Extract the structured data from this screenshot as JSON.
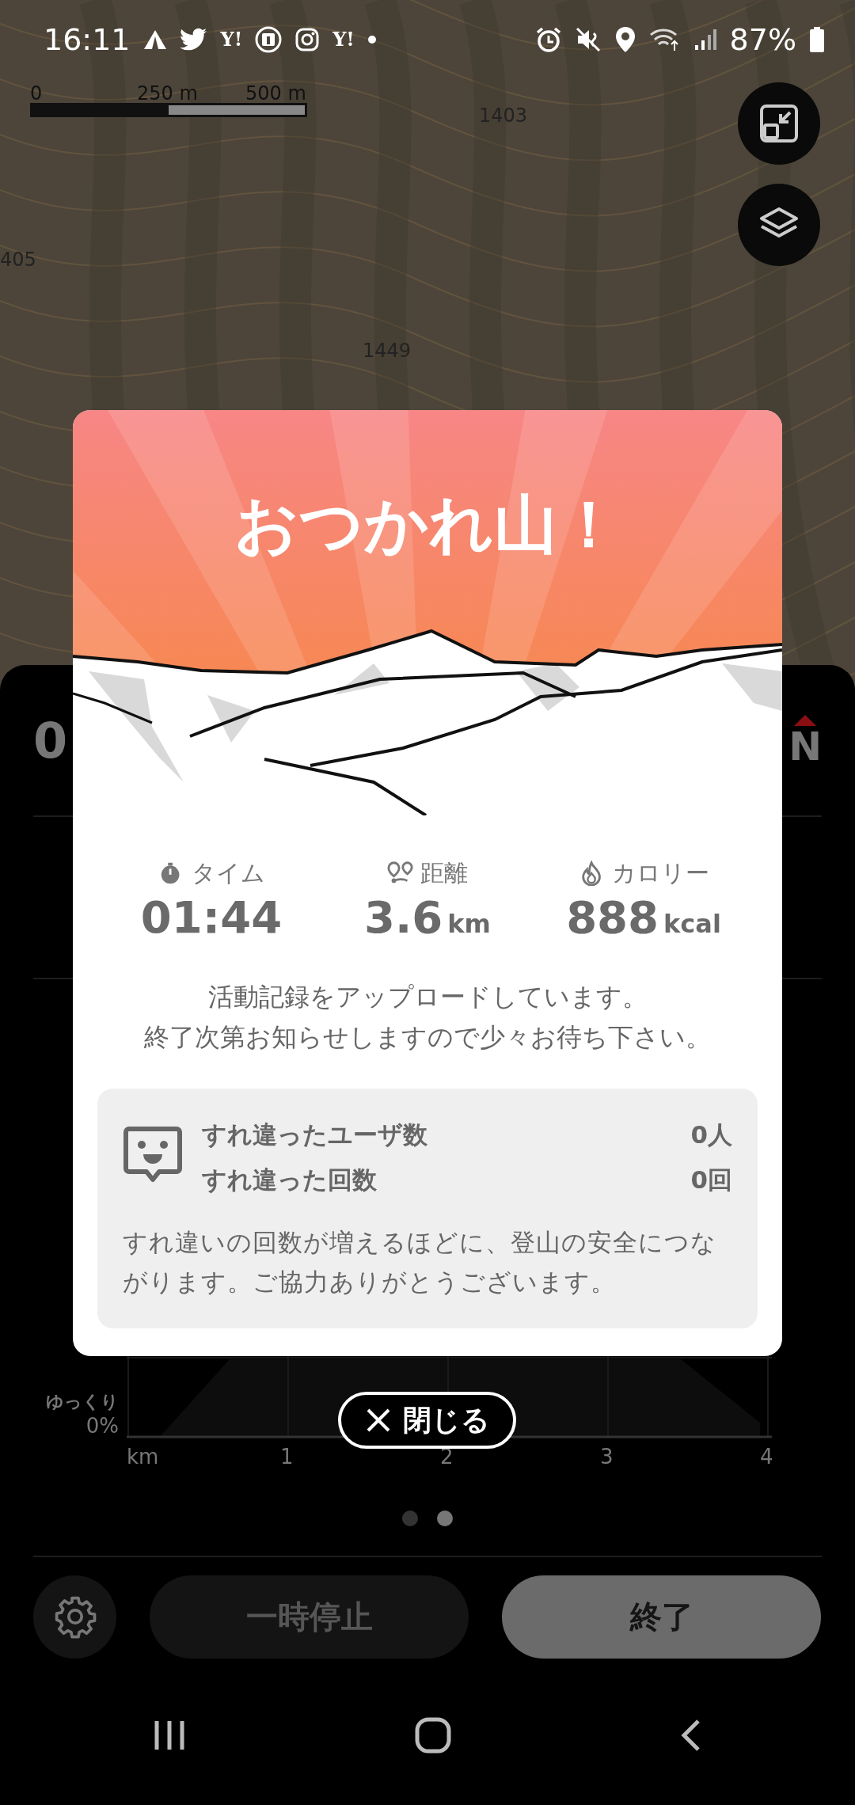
{
  "status_bar": {
    "time": "16:11",
    "app_marks": [
      "Y!",
      "Y!"
    ],
    "battery": "87%"
  },
  "map": {
    "scale_labels": [
      "0",
      "250 m",
      "500 m"
    ],
    "elevation_labels": [
      "1403",
      "405",
      "1449"
    ]
  },
  "panel": {
    "elapsed_partial": "0",
    "compass": "N",
    "chart": {
      "y_labels": [
        "ゆっくり",
        "0%"
      ],
      "x_labels": [
        "km",
        "1",
        "2",
        "3",
        "4"
      ]
    },
    "pages": [
      {
        "selected": false
      },
      {
        "selected": true
      }
    ],
    "pause_button": "一時停止",
    "end_button": "終了"
  },
  "dialog": {
    "title": "おつかれ山！",
    "stats": [
      {
        "kind": "time",
        "label": "タイム",
        "value": "01:44"
      },
      {
        "kind": "distance",
        "label": "距離",
        "value": "3.6",
        "unit": "km"
      },
      {
        "kind": "calorie",
        "label": "カロリー",
        "value": "888",
        "unit": "kcal"
      }
    ],
    "message_lines": [
      "活動記録をアップロードしています。",
      "終了次第お知らせしますので少々お待ち下さい。"
    ],
    "encounters": [
      {
        "label": "すれ違ったユーザ数",
        "value": "0人"
      },
      {
        "label": "すれ違った回数",
        "value": "0回"
      }
    ],
    "note": "すれ違いの回数が増えるほどに、登山の安全につながります。ご協力ありがとうございます。",
    "close_button": "閉じる"
  }
}
